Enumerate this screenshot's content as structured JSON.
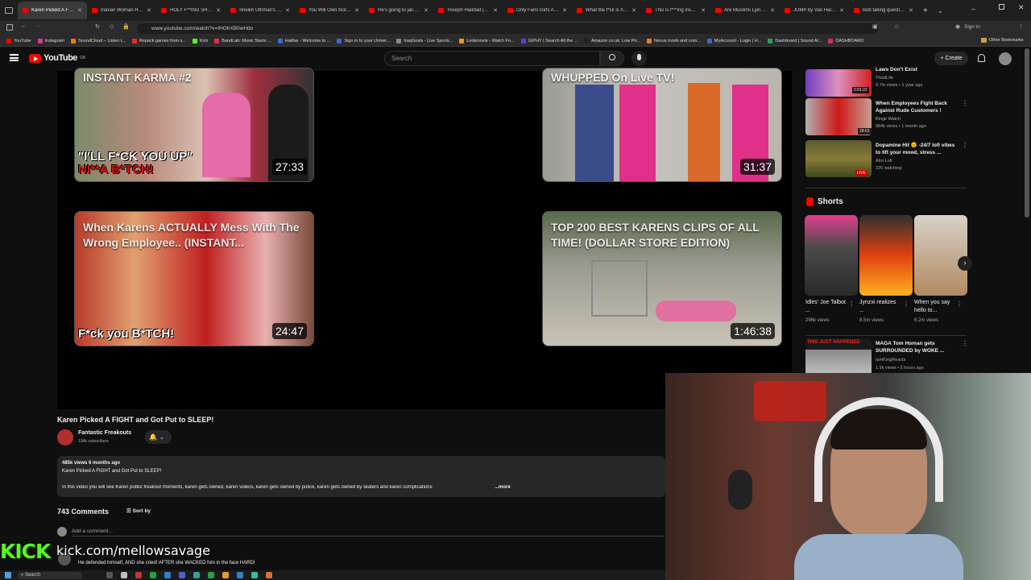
{
  "browser": {
    "tabs": [
      {
        "label": "Karen Picked A FIGHT",
        "active": true
      },
      {
        "label": "Iranian Woman Has U"
      },
      {
        "label": "HOLY F**ING SH*T..."
      },
      {
        "label": "Sheikh Uthman's Dev"
      },
      {
        "label": "You Will Own Nothing"
      },
      {
        "label": "He's going to jail... - Yo"
      },
      {
        "label": "Yoseph Haddad | This"
      },
      {
        "label": "Only Fans Girls Are M"
      },
      {
        "label": "What the f*ck is happ"
      },
      {
        "label": "This is f***ing insane..."
      },
      {
        "label": "Are Muslims Lying Ab"
      },
      {
        "label": "JUMP by Van Halen |"
      },
      {
        "label": "Bob taking questions"
      }
    ],
    "url": "www.youtube.com/watch?v=IHOhXB0wHdo",
    "signin_label": "Sign in",
    "bookmarks": [
      "YouTube",
      "Instagram",
      "SoundCloud – Listen t...",
      "Repack games from s...",
      "Kick",
      "BandLab: Music Starts ...",
      "Halifax - Welcome to ...",
      "Sign in to your Univer...",
      "IraqGoals - Live Sports...",
      "Lookmovie - Watch Fo...",
      "GIPHY | Search All the ...",
      "Amazon.co.uk: Low Pri...",
      "Nexus mods and com...",
      "MyAccount - Login | H...",
      "Dashboard | Sound Al...",
      "DASHBOARD"
    ],
    "other_bookmarks": "Other Bookmarks"
  },
  "yt": {
    "logo": "YouTube",
    "logo_sup": "GB",
    "search_placeholder": "Search",
    "create_label": "Create"
  },
  "grid": [
    {
      "title": "INSTANT KARMA #2",
      "caption": "\"I'LL F*CK YOU UP\"",
      "caption2": "NI**A B*TCH!",
      "duration": "27:33"
    },
    {
      "title": "WHUPPED On Live TV!",
      "duration": "31:37"
    },
    {
      "title": "When Karens ACTUALLY Mess With The Wrong Employee.. (INSTANT...",
      "caption": "F*ck you B*TCH!",
      "duration": "24:47"
    },
    {
      "title": "TOP 200 BEST KARENS CLIPS OF ALL TIME! (DOLLAR STORE EDITION)",
      "duration": "1:46:38"
    }
  ],
  "video": {
    "title": "Karen Picked A FIGHT and Got Put to SLEEP!",
    "channel": "Fantastic Freakouts",
    "subs": "134k subscribers",
    "stats": "485k views  6 months ago",
    "desc_line1": "Karen Picked A FIGHT and Got Put to SLEEP!",
    "desc_line2": "In this video you will see Karen public freakout moments, karen gets owned, karen videos, karen gets owned by police, karen gets owned by skaters and karen complications",
    "more": "...more",
    "comments_count": "743 Comments",
    "sort_label": "Sort by",
    "add_comment": "Add a comment...",
    "top_comment": "He defended himself, AND she cried! AFTER she WACKED  him in the face HARD!"
  },
  "overlay": {
    "kick_logo": "KICK",
    "kick_url": "kick.com/mellowsavage"
  },
  "sidebar": {
    "items": [
      {
        "title": "Laws Don't Exist",
        "channel": "ThistiLife",
        "meta": "9.7m views • 1 year ago",
        "duration": "2:01:22"
      },
      {
        "title": "When Employees Fight Back Against Rude Customers !",
        "channel": "Binge Watch",
        "meta": "984k views • 1 month ago",
        "duration": "28:01"
      },
      {
        "title": "Dopamine Hit 🌞 -24/7 lofi vibes to lift your mood, stress ...",
        "channel": "Afro Lofi",
        "meta": "226 watching",
        "duration": "LIVE"
      }
    ],
    "shorts_heading": "Shorts",
    "shorts": [
      {
        "title": "Idles' Joe Talbot ...",
        "views": "296k views"
      },
      {
        "title": "Jynzxi realizes ...",
        "views": "8.5m views"
      },
      {
        "title": "When you say hello to...",
        "views": "6.2m views"
      }
    ],
    "bottom_item": {
      "title": "MAGA Tom Homan gets SURROUNDED by WOKE ...",
      "channel": "IamKingReacts",
      "meta": "1.9k views • 5 hours ago",
      "badge": "THIS JUST HAPPENED"
    }
  },
  "taskbar": {
    "search": "Search"
  }
}
